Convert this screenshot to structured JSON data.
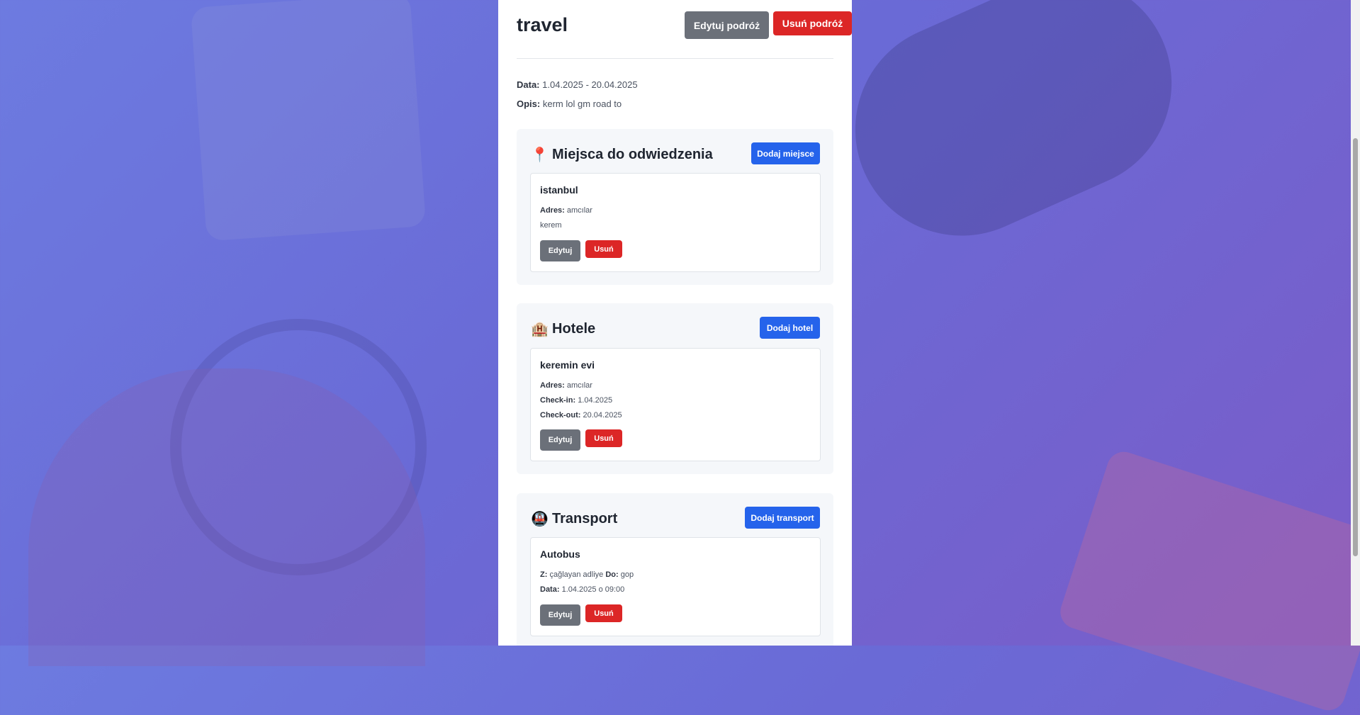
{
  "trip": {
    "title": "travel",
    "edit_label": "Edytuj podróż",
    "delete_label": "Usuń podróż",
    "date_label": "Data:",
    "date_value": "1.04.2025 - 20.04.2025",
    "desc_label": "Opis:",
    "desc_value": "kerm lol gm road to"
  },
  "places": {
    "icon": "📍",
    "icon_name": "pin-icon",
    "title": "Miejsca do odwiedzenia",
    "add_label": "Dodaj miejsce",
    "items": [
      {
        "name": "istanbul",
        "address_label": "Adres:",
        "address": "amcılar",
        "note": "kerem",
        "edit_label": "Edytuj",
        "delete_label": "Usuń"
      }
    ]
  },
  "hotels": {
    "icon": "🏨",
    "icon_name": "hotel-icon",
    "title": "Hotele",
    "add_label": "Dodaj hotel",
    "items": [
      {
        "name": "keremin evi",
        "address_label": "Adres:",
        "address": "amcılar",
        "checkin_label": "Check-in:",
        "checkin": "1.04.2025",
        "checkout_label": "Check-out:",
        "checkout": "20.04.2025",
        "edit_label": "Edytuj",
        "delete_label": "Usuń"
      }
    ]
  },
  "transport": {
    "icon": "🚇",
    "icon_name": "metro-icon",
    "title": "Transport",
    "add_label": "Dodaj transport",
    "items": [
      {
        "name": "Autobus",
        "from_label": "Z:",
        "from": "çağlayan adliye",
        "to_label": "Do:",
        "to": "gop",
        "date_label": "Data:",
        "date": "1.04.2025 o 09:00",
        "edit_label": "Edytuj",
        "delete_label": "Usuń"
      }
    ]
  },
  "colors": {
    "primary": "#2563eb",
    "danger": "#dc2626",
    "secondary": "#6b7079"
  }
}
